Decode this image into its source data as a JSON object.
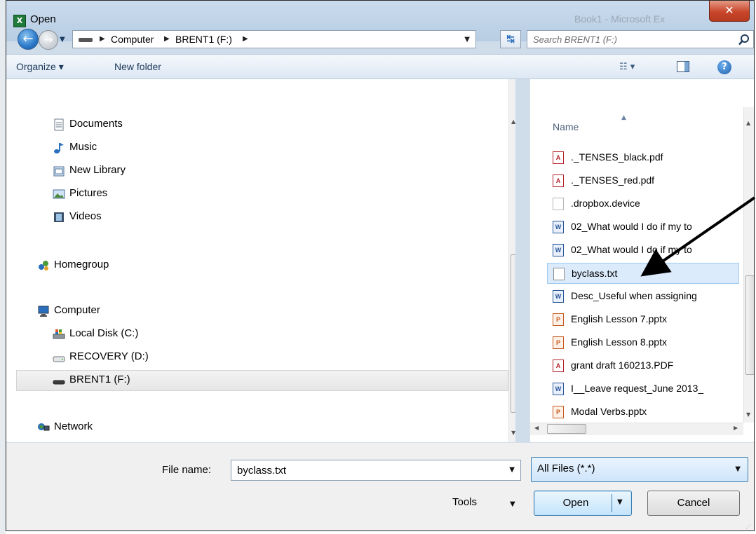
{
  "window": {
    "title": "Open",
    "background_title": "Book1 - Microsoft Ex"
  },
  "nav_bar": {
    "breadcrumbs": [
      "Computer",
      "BRENT1 (F:)"
    ],
    "search_placeholder": "Search BRENT1 (F:)"
  },
  "toolbar": {
    "organize_label": "Organize ▾",
    "new_folder_label": "New folder"
  },
  "nav_pane": {
    "items": [
      {
        "label": "Documents",
        "icon": "documents-icon"
      },
      {
        "label": "Music",
        "icon": "music-icon"
      },
      {
        "label": "New Library",
        "icon": "library-icon"
      },
      {
        "label": "Pictures",
        "icon": "pictures-icon"
      },
      {
        "label": "Videos",
        "icon": "videos-icon"
      },
      {
        "label": "Homegroup",
        "icon": "homegroup-icon"
      },
      {
        "label": "Computer",
        "icon": "computer-icon"
      },
      {
        "label": "Local Disk (C:)",
        "icon": "local-disk-icon"
      },
      {
        "label": "RECOVERY (D:)",
        "icon": "drive-icon"
      },
      {
        "label": "BRENT1 (F:)",
        "icon": "drive-icon",
        "selected": true
      },
      {
        "label": "Network",
        "icon": "network-icon"
      }
    ]
  },
  "file_list": {
    "column_name": "Name",
    "files": [
      {
        "name": "._TENSES_black.pdf",
        "type": "pdf"
      },
      {
        "name": "._TENSES_red.pdf",
        "type": "pdf"
      },
      {
        "name": ".dropbox.device",
        "type": "blank"
      },
      {
        "name": "02_What would I do if my to",
        "type": "doc"
      },
      {
        "name": "02_What would I do if my to",
        "type": "doc"
      },
      {
        "name": "byclass.txt",
        "type": "txt",
        "selected": true
      },
      {
        "name": "Desc_Useful when assigning",
        "type": "doc"
      },
      {
        "name": "English Lesson 7.pptx",
        "type": "ppt"
      },
      {
        "name": "English Lesson 8.pptx",
        "type": "ppt"
      },
      {
        "name": "grant draft 160213.PDF",
        "type": "pdf"
      },
      {
        "name": "I__Leave request_June 2013_",
        "type": "doc"
      },
      {
        "name": "Modal Verbs.pptx",
        "type": "ppt"
      }
    ]
  },
  "bottom": {
    "file_name_label": "File name:",
    "file_name_value": "byclass.txt",
    "file_type_value": "All Files (*.*)",
    "tools_label": "Tools",
    "open_label": "Open",
    "cancel_label": "Cancel"
  },
  "colors": {
    "selection": "#dcebfc",
    "chrome": "#cfdcea",
    "accent": "#3c7fb1"
  }
}
